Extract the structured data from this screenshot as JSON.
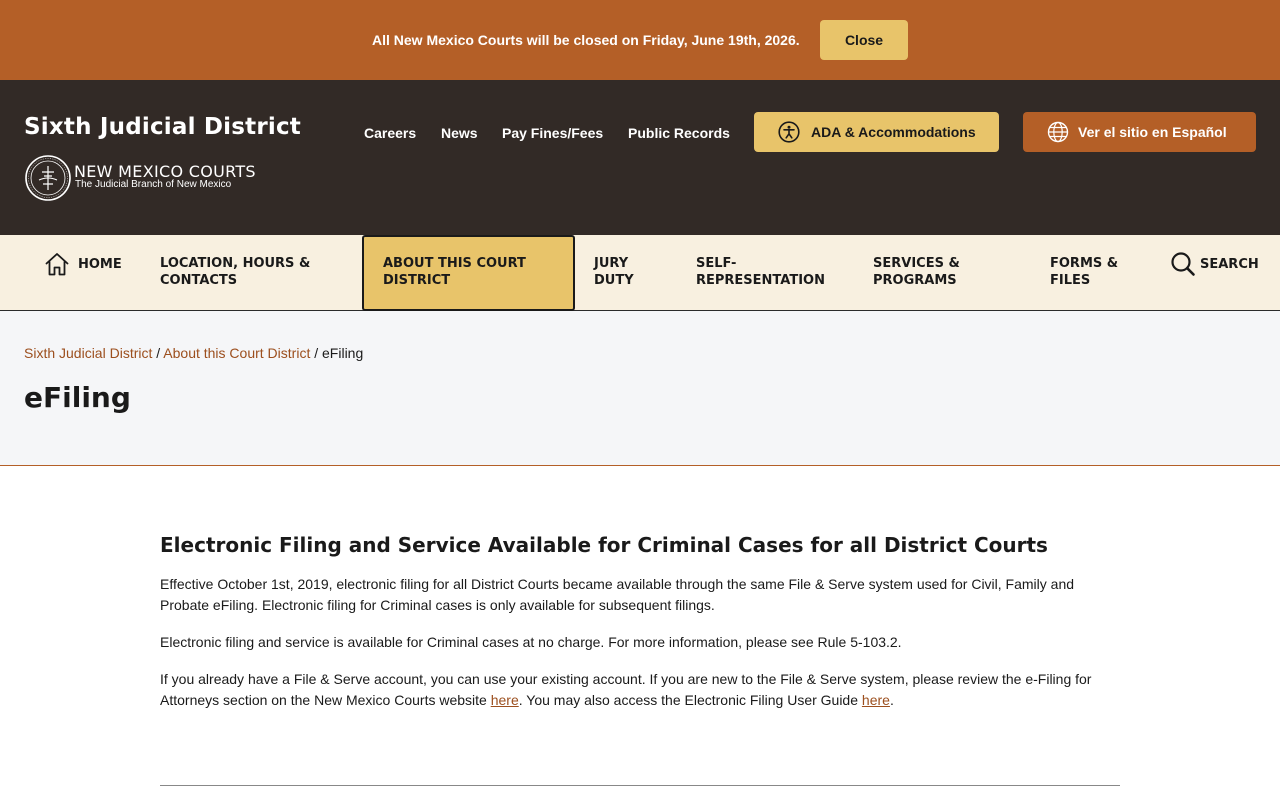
{
  "alert": {
    "message": "All New Mexico Courts will be closed on Friday, June 19th, 2026.",
    "close_label": "Close"
  },
  "header": {
    "site_title": "Sixth Judicial District",
    "logo_main": "NEW MEXICO COURTS",
    "logo_sub": "The Judicial Branch of New Mexico",
    "utility_links": [
      "Careers",
      "News",
      "Pay Fines/Fees",
      "Public Records"
    ],
    "ada_label": "ADA & Accommodations",
    "spanish_label": "Ver el sitio en Español"
  },
  "nav": {
    "home": "HOME",
    "location": [
      "LOCATION, HOURS &",
      "CONTACTS"
    ],
    "about": [
      "ABOUT THIS COURT",
      "DISTRICT"
    ],
    "jury": [
      "JURY",
      "DUTY"
    ],
    "self": [
      "SELF-",
      "REPRESENTATION"
    ],
    "services": [
      "SERVICES &",
      "PROGRAMS"
    ],
    "forms": [
      "FORMS &",
      "FILES"
    ],
    "search": "SEARCH"
  },
  "breadcrumb": {
    "items": [
      "Sixth Judicial District",
      "About this Court District"
    ],
    "current": "eFiling",
    "separator": "/"
  },
  "page": {
    "title": "eFiling",
    "heading": "Electronic Filing and Service Available for Criminal Cases for all District Courts",
    "p1": "Effective October 1st, 2019, electronic filing for all District Courts became available through the same File & Serve system used for Civil, Family and Probate eFiling. Electronic filing for Criminal cases is only available for subsequent filings.",
    "p2": "Electronic filing and service is available for Criminal cases at no charge. For more information, please see Rule 5-103.2.",
    "p3_a": "If you already have a File & Serve account, you can use your existing account. If you are new to the File & Serve system, please review the e-Filing for Attorneys section on the New Mexico Courts website ",
    "p3_link1": "here",
    "p3_b": ". You may also access the Electronic Filing User Guide ",
    "p3_link2": "here",
    "p3_c": "."
  },
  "colors": {
    "brand_orange": "#b45f27",
    "brand_gold": "#e8c46a",
    "header_dark": "#322a26",
    "nav_cream": "#f8f0e0"
  }
}
